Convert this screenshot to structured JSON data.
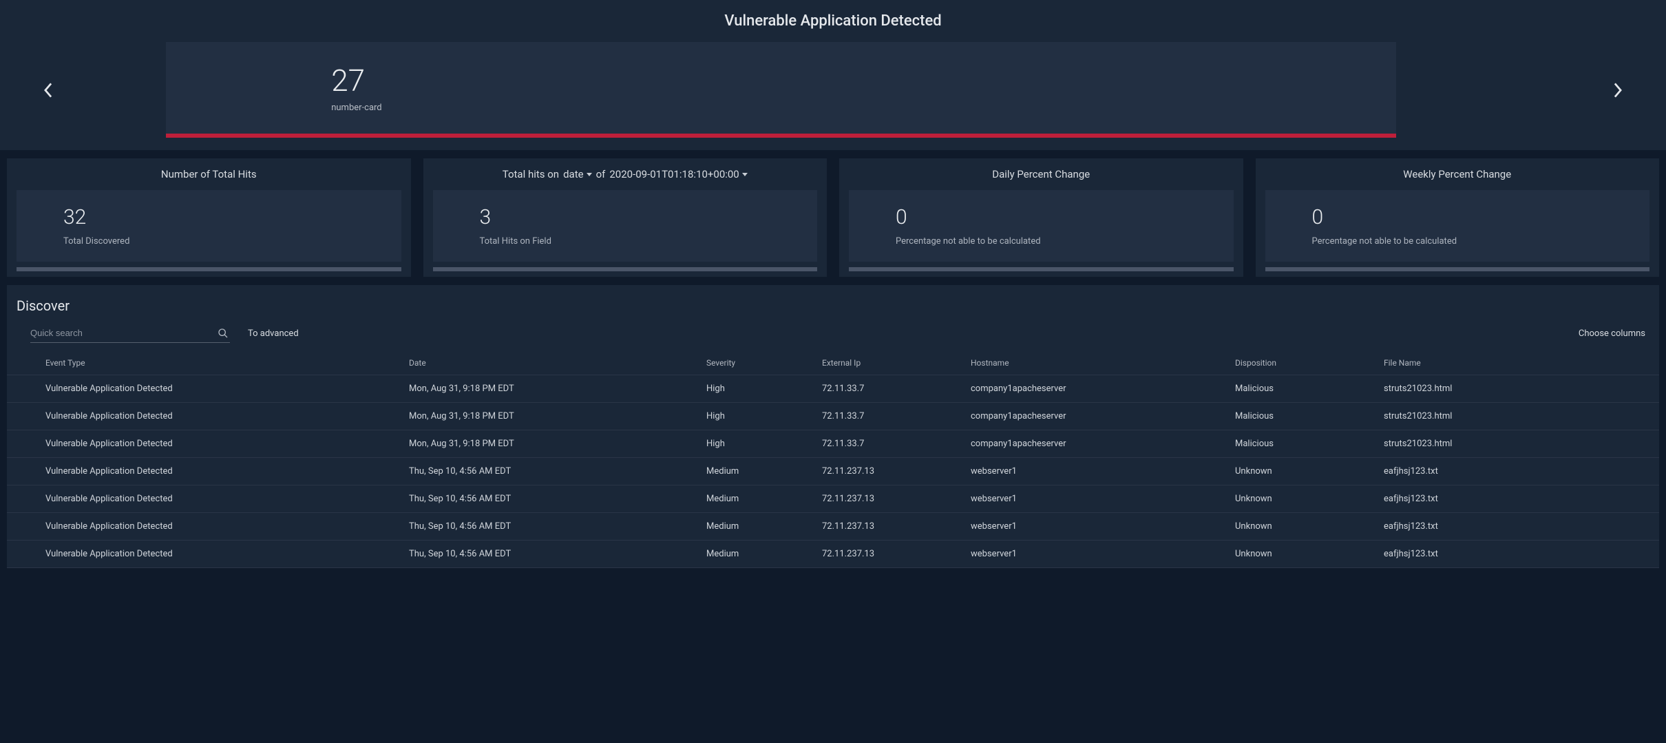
{
  "header": {
    "title": "Vulnerable Application Detected",
    "hero": {
      "value": "27",
      "label": "number-card"
    }
  },
  "stats": [
    {
      "title_parts": [
        "Number of Total Hits"
      ],
      "value": "32",
      "label": "Total Discovered"
    },
    {
      "title_parts": [
        "Total hits on",
        "date",
        "of",
        "2020-09-01T01:18:10+00:00"
      ],
      "value": "3",
      "label": "Total Hits on Field",
      "has_dropdowns": true
    },
    {
      "title_parts": [
        "Daily Percent Change"
      ],
      "value": "0",
      "label": "Percentage not able to be calculated"
    },
    {
      "title_parts": [
        "Weekly Percent Change"
      ],
      "value": "0",
      "label": "Percentage not able to be calculated"
    }
  ],
  "discover": {
    "title": "Discover",
    "search_placeholder": "Quick search",
    "to_advanced": "To advanced",
    "choose_columns": "Choose columns",
    "columns": [
      "Event Type",
      "Date",
      "Severity",
      "External Ip",
      "Hostname",
      "Disposition",
      "File Name"
    ],
    "rows": [
      {
        "event": "Vulnerable Application Detected",
        "date": "Mon, Aug 31, 9:18 PM EDT",
        "severity": "High",
        "ip": "72.11.33.7",
        "hostname": "company1apacheserver",
        "disposition": "Malicious",
        "filename": "struts21023.html"
      },
      {
        "event": "Vulnerable Application Detected",
        "date": "Mon, Aug 31, 9:18 PM EDT",
        "severity": "High",
        "ip": "72.11.33.7",
        "hostname": "company1apacheserver",
        "disposition": "Malicious",
        "filename": "struts21023.html"
      },
      {
        "event": "Vulnerable Application Detected",
        "date": "Mon, Aug 31, 9:18 PM EDT",
        "severity": "High",
        "ip": "72.11.33.7",
        "hostname": "company1apacheserver",
        "disposition": "Malicious",
        "filename": "struts21023.html"
      },
      {
        "event": "Vulnerable Application Detected",
        "date": "Thu, Sep 10, 4:56 AM EDT",
        "severity": "Medium",
        "ip": "72.11.237.13",
        "hostname": "webserver1",
        "disposition": "Unknown",
        "filename": "eafjhsj123.txt"
      },
      {
        "event": "Vulnerable Application Detected",
        "date": "Thu, Sep 10, 4:56 AM EDT",
        "severity": "Medium",
        "ip": "72.11.237.13",
        "hostname": "webserver1",
        "disposition": "Unknown",
        "filename": "eafjhsj123.txt"
      },
      {
        "event": "Vulnerable Application Detected",
        "date": "Thu, Sep 10, 4:56 AM EDT",
        "severity": "Medium",
        "ip": "72.11.237.13",
        "hostname": "webserver1",
        "disposition": "Unknown",
        "filename": "eafjhsj123.txt"
      },
      {
        "event": "Vulnerable Application Detected",
        "date": "Thu, Sep 10, 4:56 AM EDT",
        "severity": "Medium",
        "ip": "72.11.237.13",
        "hostname": "webserver1",
        "disposition": "Unknown",
        "filename": "eafjhsj123.txt"
      }
    ]
  }
}
